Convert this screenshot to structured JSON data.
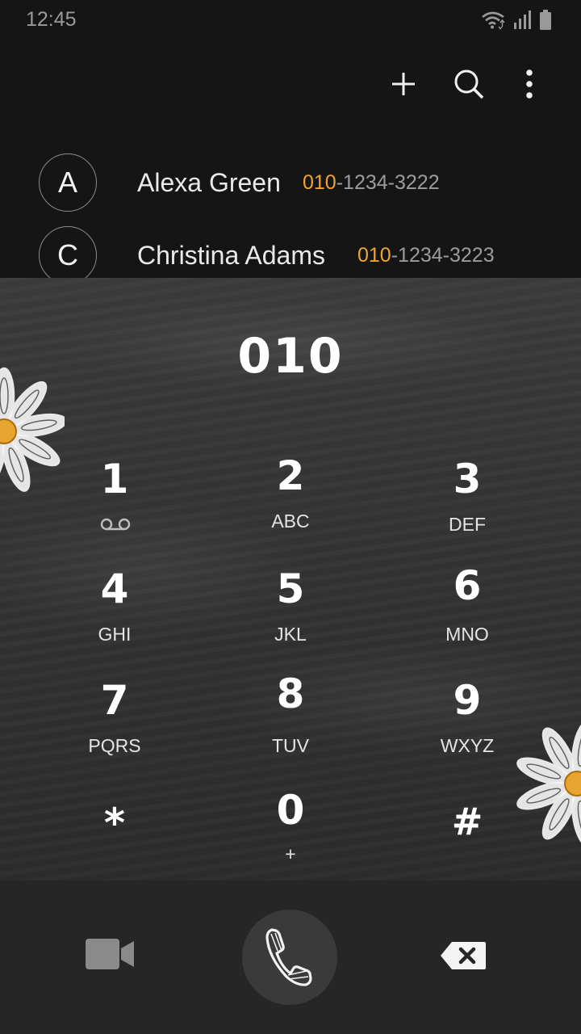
{
  "status_bar": {
    "time": "12:45",
    "icons": [
      "wifi-icon",
      "signal-icon",
      "battery-icon"
    ]
  },
  "header": {
    "actions": [
      "add-icon",
      "search-icon",
      "more-options-icon"
    ]
  },
  "contacts": [
    {
      "initial": "A",
      "name": "Alexa Green",
      "number_match": "010",
      "number_rest": "-1234-3222"
    },
    {
      "initial": "C",
      "name": "Christina Adams",
      "number_match": "010",
      "number_rest": "-1234-3223"
    }
  ],
  "dialer": {
    "entered_number": "010",
    "keys": [
      {
        "digit": "1",
        "letters": "",
        "sub_icon": "voicemail-icon"
      },
      {
        "digit": "2",
        "letters": "ABC"
      },
      {
        "digit": "3",
        "letters": "DEF"
      },
      {
        "digit": "4",
        "letters": "GHI"
      },
      {
        "digit": "5",
        "letters": "JKL"
      },
      {
        "digit": "6",
        "letters": "MNO"
      },
      {
        "digit": "7",
        "letters": "PQRS"
      },
      {
        "digit": "8",
        "letters": "TUV"
      },
      {
        "digit": "9",
        "letters": "WXYZ"
      },
      {
        "digit": "*",
        "letters": ""
      },
      {
        "digit": "0",
        "letters": "+"
      },
      {
        "digit": "#",
        "letters": ""
      }
    ]
  },
  "bottom_bar": {
    "actions": [
      "video-call-icon",
      "phone-call-icon",
      "backspace-icon"
    ]
  },
  "colors": {
    "match_highlight": "#f0a52a",
    "background": "#151515",
    "chalkboard": "#353535",
    "call_button": "#3a3a3a"
  }
}
